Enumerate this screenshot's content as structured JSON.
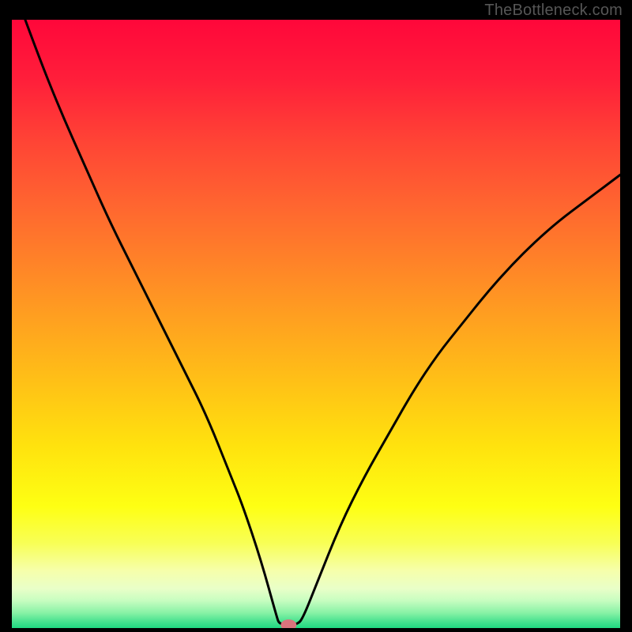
{
  "watermark": "TheBottleneck.com",
  "chart_data": {
    "type": "line",
    "title": "",
    "xlabel": "",
    "ylabel": "",
    "xlim": [
      0,
      100
    ],
    "ylim": [
      0,
      100
    ],
    "series": [
      {
        "name": "bottleneck-curve",
        "x": [
          0,
          4,
          8,
          12,
          16,
          20,
          24,
          28,
          32,
          36,
          38,
          41,
          43.5,
          44,
          47,
          48,
          50,
          54,
          58,
          62,
          66,
          70,
          74,
          78,
          82,
          86,
          90,
          94,
          98,
          100
        ],
        "y": [
          106,
          95,
          85,
          76,
          67,
          59,
          51,
          43,
          35,
          25,
          20,
          11,
          2,
          0.5,
          0.5,
          2,
          7,
          17,
          25,
          32,
          39,
          45,
          50,
          55,
          59.5,
          63.5,
          67,
          70,
          73,
          74.5
        ]
      }
    ],
    "marker": {
      "x": 45.5,
      "y": 0.5
    },
    "gradient_stops": [
      {
        "offset": 0.0,
        "color": "#ff073a"
      },
      {
        "offset": 0.1,
        "color": "#ff1f3a"
      },
      {
        "offset": 0.2,
        "color": "#ff4435"
      },
      {
        "offset": 0.3,
        "color": "#ff6430"
      },
      {
        "offset": 0.4,
        "color": "#ff8328"
      },
      {
        "offset": 0.5,
        "color": "#ffa31f"
      },
      {
        "offset": 0.6,
        "color": "#ffc216"
      },
      {
        "offset": 0.7,
        "color": "#ffe20e"
      },
      {
        "offset": 0.8,
        "color": "#feff13"
      },
      {
        "offset": 0.86,
        "color": "#f8ff55"
      },
      {
        "offset": 0.905,
        "color": "#f6ffaa"
      },
      {
        "offset": 0.935,
        "color": "#e9ffc8"
      },
      {
        "offset": 0.955,
        "color": "#c7fdc0"
      },
      {
        "offset": 0.975,
        "color": "#88f2a6"
      },
      {
        "offset": 0.99,
        "color": "#45e18f"
      },
      {
        "offset": 1.0,
        "color": "#20d881"
      }
    ],
    "grid": false,
    "legend": false
  }
}
